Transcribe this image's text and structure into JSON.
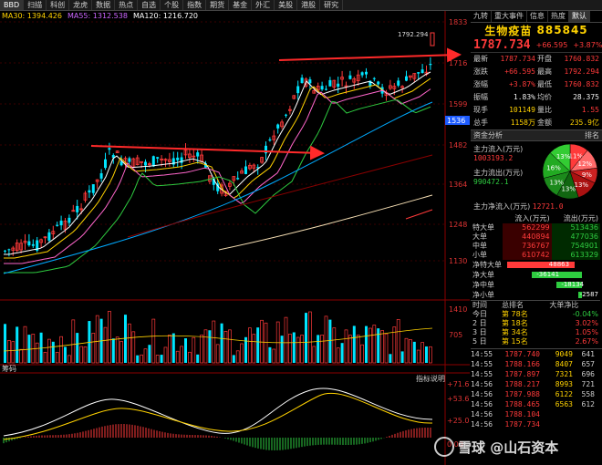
{
  "toolbar": {
    "items": [
      "BBD",
      "扫描",
      "科创",
      "龙虎",
      "数据",
      "热点",
      "自选",
      "个股",
      "指数",
      "期货",
      "基金",
      "外汇",
      "美股",
      "港股",
      "研究"
    ]
  },
  "ma_legend": [
    {
      "label": "MA30: 1394.426",
      "color": "#ffd200"
    },
    {
      "label": "MA55: 1312.538",
      "color": "#cc66ff"
    },
    {
      "label": "MA120: 1216.720",
      "color": "#ffffff"
    }
  ],
  "price_axis": {
    "labels": [
      "1833",
      "1716",
      "1599",
      "1482",
      "1364",
      "1248",
      "1130"
    ],
    "current_box": "1536"
  },
  "volume_axis": {
    "labels": [
      "1410",
      "705"
    ]
  },
  "indicator_axis": {
    "labels": [
      "+71.62",
      "+53.69",
      "+25.00",
      "0.00"
    ]
  },
  "indicator_title": "指标说明",
  "indicator_name": "筹码",
  "peak_label": "1792.294",
  "right_panel": {
    "tabs": [
      "九转",
      "重大事件",
      "信息",
      "热度",
      "默认"
    ],
    "stock_name": "生物疫苗",
    "stock_code": "885845",
    "price": "1787.734",
    "change": "+66.595",
    "change_pct": "+3.87%",
    "quote": [
      {
        "l1": "最新",
        "v1": "1787.734",
        "c1": "red",
        "l2": "开盘",
        "v2": "1760.832",
        "c2": "red"
      },
      {
        "l1": "涨跌",
        "v1": "+66.595",
        "c1": "red",
        "l2": "最高",
        "v2": "1792.294",
        "c2": "red"
      },
      {
        "l1": "涨幅",
        "v1": "+3.87%",
        "c1": "red",
        "l2": "最低",
        "v2": "1760.832",
        "c2": "red"
      },
      {
        "l1": "振幅",
        "v1": "1.83%",
        "c1": "white",
        "l2": "均价",
        "v2": "28.375",
        "c2": "white"
      },
      {
        "l1": "现手",
        "v1": "101149",
        "c1": "yellow",
        "l2": "量比",
        "v2": "1.55",
        "c2": "red"
      },
      {
        "l1": "总手",
        "v1": "1158万",
        "c1": "yellow",
        "l2": "金额",
        "v2": "235.9亿",
        "c2": "yellow"
      }
    ],
    "fund_section": {
      "title": "资金分析",
      "tab2": "排名"
    },
    "main_in_label": "主力流入(万元)",
    "main_in_value": "1003193.2",
    "main_out_label": "主力流出(万元)",
    "main_out_value": "990472.1",
    "net_label": "主力净流入(万元)",
    "net_value": "12721.0",
    "pie": [
      {
        "label": "11%",
        "value": 11,
        "color": "#ff3a3a"
      },
      {
        "label": "12%",
        "value": 12,
        "color": "#ff6a6a"
      },
      {
        "label": "9%",
        "value": 9,
        "color": "#cc2222"
      },
      {
        "label": "13%",
        "value": 13,
        "color": "#aa1111"
      },
      {
        "label": "13%",
        "value": 13,
        "color": "#116611"
      },
      {
        "label": "13%",
        "value": 13,
        "color": "#1c8a1c"
      },
      {
        "label": "16%",
        "value": 16,
        "color": "#22aa22"
      },
      {
        "label": "13%",
        "value": 13,
        "color": "#33cc33"
      }
    ],
    "flow_header": [
      "",
      "流入(万元)",
      "流出(万元)"
    ],
    "flow_rows": [
      {
        "name": "特大单",
        "in": "562299",
        "out": "513436"
      },
      {
        "name": "大单",
        "in": "440894",
        "out": "477036"
      },
      {
        "name": "中单",
        "in": "736767",
        "out": "754901"
      },
      {
        "name": "小单",
        "in": "610742",
        "out": "613329"
      }
    ],
    "net_rows": [
      {
        "name": "净特大单",
        "value": "48863",
        "sign": "pos",
        "ratio": 0.9
      },
      {
        "name": "净大单",
        "value": "-36141",
        "sign": "neg",
        "ratio": 0.67
      },
      {
        "name": "净中单",
        "value": "-18134",
        "sign": "neg",
        "ratio": 0.34
      },
      {
        "name": "净小单",
        "value": "-2587",
        "sign": "neg",
        "ratio": 0.05
      }
    ],
    "rank_header": [
      "时间",
      "总排名",
      "大单净比"
    ],
    "rank_rows": [
      {
        "t": "今日",
        "r": "第  78名",
        "v": "-0.04%"
      },
      {
        "t": "2 日",
        "r": "第  18名",
        "v": "3.02%"
      },
      {
        "t": "3 日",
        "r": "第  34名",
        "v": "1.05%"
      },
      {
        "t": "5 日",
        "r": "第  15名",
        "v": "2.67%"
      }
    ],
    "ticks": [
      {
        "t": "14:55",
        "p": "1787.740",
        "v": "9049",
        "n": "641"
      },
      {
        "t": "14:55",
        "p": "1788.166",
        "v": "8407",
        "n": "657"
      },
      {
        "t": "14:55",
        "p": "1787.897",
        "v": "7321",
        "v2": "",
        "n": "696"
      },
      {
        "t": "14:56",
        "p": "1788.217",
        "v": "8993",
        "n": "721"
      },
      {
        "t": "14:56",
        "p": "1787.988",
        "v": "6122",
        "n": "558"
      },
      {
        "t": "14:56",
        "p": "1788.465",
        "v": "6563",
        "n": "612"
      },
      {
        "t": "14:56",
        "p": "1788.104",
        "v": "",
        "n": ""
      },
      {
        "t": "14:56",
        "p": "1787.734",
        "v": "",
        "n": ""
      }
    ]
  },
  "watermark": "雪球 @山石资本"
}
